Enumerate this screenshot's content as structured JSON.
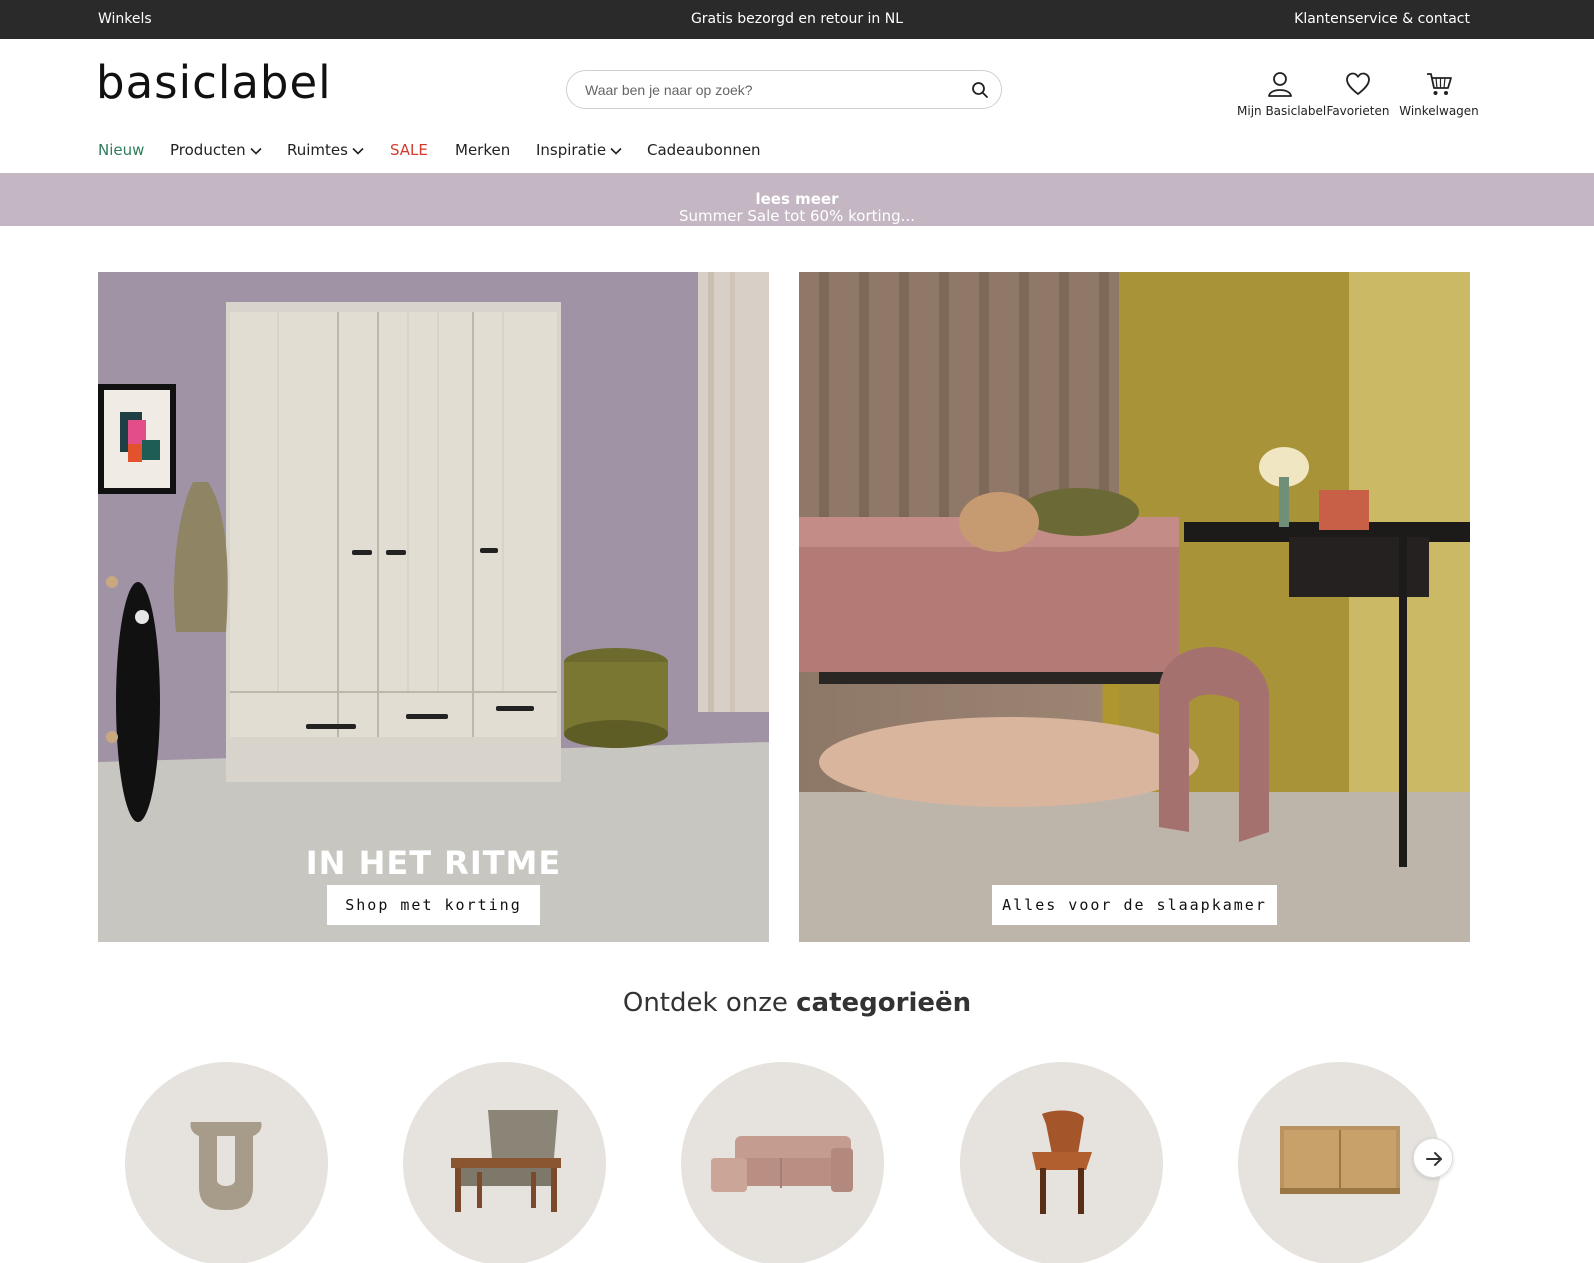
{
  "topbar": {
    "left": "Winkels",
    "center": "Gratis bezorgd en retour in NL",
    "right": "Klantenservice & contact"
  },
  "header": {
    "logo": "basiclabel",
    "search_placeholder": "Waar ben je naar op zoek?",
    "account": [
      {
        "label": "Mijn Basiclabel",
        "icon": "user-icon"
      },
      {
        "label": "Favorieten",
        "icon": "heart-icon"
      },
      {
        "label": "Winkelwagen",
        "icon": "cart-icon"
      }
    ]
  },
  "nav": {
    "items": [
      {
        "label": "Nieuw"
      },
      {
        "label": "Producten"
      },
      {
        "label": "Ruimtes"
      },
      {
        "label": "SALE"
      },
      {
        "label": "Merken"
      },
      {
        "label": "Inspiratie"
      },
      {
        "label": "Cadeaubonnen"
      }
    ]
  },
  "promo": {
    "text": "Summer Sale tot 60% korting...",
    "link": "lees meer"
  },
  "heroes": [
    {
      "title": "IN HET RITME",
      "button": "Shop met korting"
    },
    {
      "title": "",
      "button": "Alles voor de slaapkamer"
    }
  ],
  "categories": {
    "heading_normal": "Ontdek onze",
    "heading_bold": "categorieën",
    "items": [
      {
        "icon": "vase-image"
      },
      {
        "icon": "armchair-image"
      },
      {
        "icon": "sofa-image"
      },
      {
        "icon": "chair-image"
      },
      {
        "icon": "cabinet-image"
      }
    ]
  },
  "colors": {
    "topbar": "#2a2a2a",
    "promo": "#c4b7c3",
    "nav_new": "#2e7d5b",
    "nav_sale": "#d33a2c",
    "category_bg": "#e6e3de"
  }
}
